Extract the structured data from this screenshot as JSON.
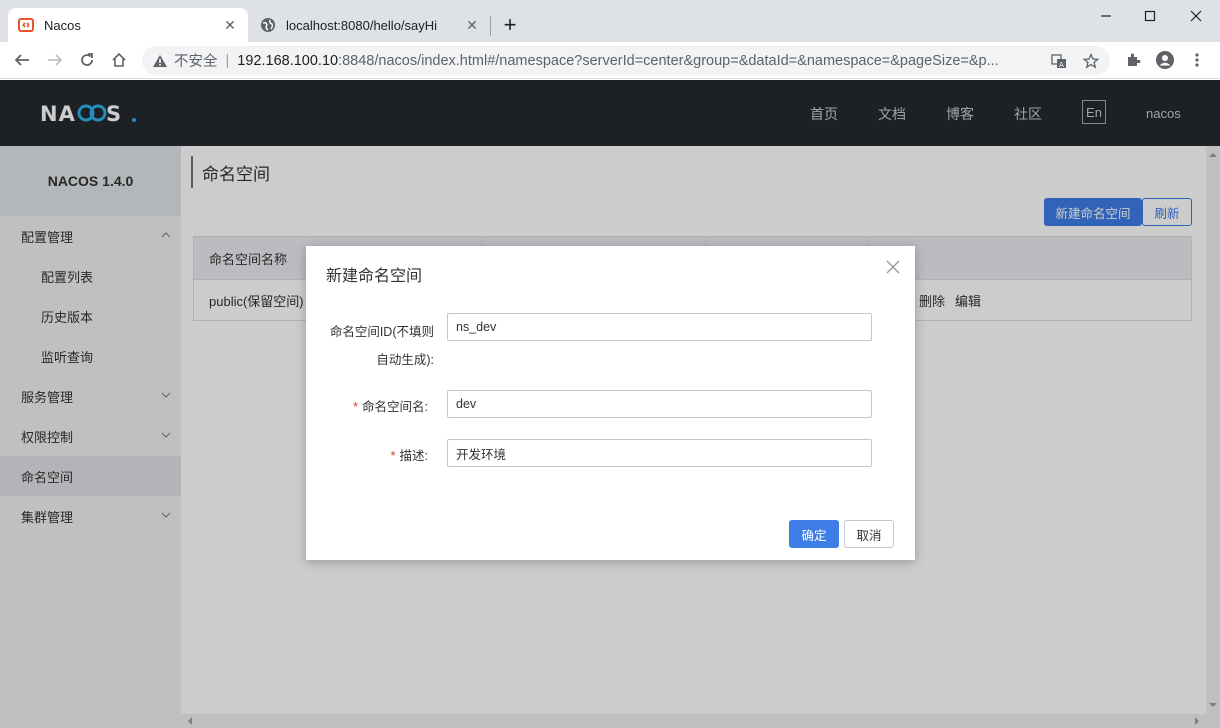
{
  "browser": {
    "tabs": [
      {
        "title": "Nacos",
        "active": true
      },
      {
        "title": "localhost:8080/hello/sayHi",
        "active": false
      }
    ],
    "address": {
      "insecure_label": "不安全",
      "host": "192.168.100.10",
      "path": ":8848/nacos/index.html#/namespace?serverId=center&group=&dataId=&namespace=&pageSize=&p..."
    }
  },
  "header": {
    "logo": "NACOS.",
    "nav": [
      "首页",
      "文档",
      "博客",
      "社区"
    ],
    "lang": "En",
    "user": "nacos"
  },
  "sidebar": {
    "version": "NACOS 1.4.0",
    "items": [
      {
        "label": "配置管理",
        "type": "group",
        "expanded": true
      },
      {
        "label": "配置列表",
        "type": "sub"
      },
      {
        "label": "历史版本",
        "type": "sub"
      },
      {
        "label": "监听查询",
        "type": "sub"
      },
      {
        "label": "服务管理",
        "type": "group",
        "expanded": false
      },
      {
        "label": "权限控制",
        "type": "group",
        "expanded": false
      },
      {
        "label": "命名空间",
        "type": "item",
        "active": true
      },
      {
        "label": "集群管理",
        "type": "group",
        "expanded": false
      }
    ]
  },
  "main": {
    "title": "命名空间",
    "new_button": "新建命名空间",
    "refresh_button": "刷新",
    "table": {
      "headers": [
        "命名空间名称"
      ],
      "rows": [
        {
          "name": "public(保留空间)",
          "actions": [
            "删除",
            "编辑"
          ]
        }
      ]
    }
  },
  "dialog": {
    "title": "新建命名空间",
    "fields": {
      "id_label_line1": "命名空间ID(不填则",
      "id_label_line2": "自动生成):",
      "id_value": "ns_dev",
      "name_label": "命名空间名:",
      "name_value": "dev",
      "desc_label": "描述:",
      "desc_value": "开发环境",
      "required_mark": "*"
    },
    "confirm": "确定",
    "cancel": "取消"
  },
  "colors": {
    "primary": "#3e7ce6",
    "header_bg": "#252a2f",
    "required": "#d23c26"
  }
}
